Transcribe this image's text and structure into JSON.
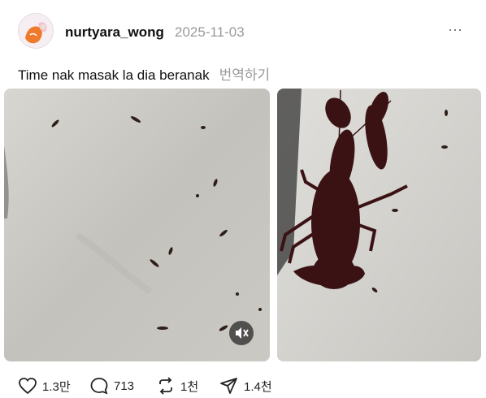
{
  "post": {
    "username": "nurtyara_wong",
    "date": "2025-11-03",
    "more_label": "···",
    "caption": "Time nak masak la dia beranak",
    "translate_label": "번역하기"
  },
  "media": {
    "left_alt": "video of baby crayfish on a white surface",
    "right_alt": "photo of a dark crayfish on a white surface",
    "mute_icon": "speaker-muted-icon"
  },
  "actions": {
    "like_count": "1.3만",
    "comment_count": "713",
    "repost_count": "1천",
    "share_count": "1.4천"
  },
  "colors": {
    "text_primary": "#111111",
    "text_secondary": "#9a9a9a",
    "crayfish": "#3a1214"
  }
}
